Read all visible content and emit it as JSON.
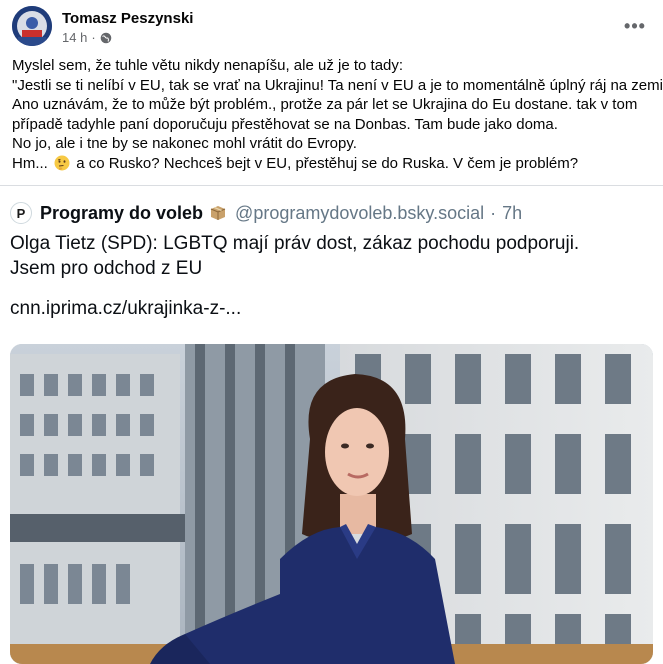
{
  "post": {
    "author": "Tomasz Peszynski",
    "time": "14 h",
    "separator": "·",
    "more_label": "•••",
    "lines": [
      "Myslel sem, že tuhle větu nikdy nenapíšu, ale už je to tady:",
      "\"Jestli se ti nelíbí v EU, tak se vrať na Ukrajinu! Ta není v EU a je to momentálně úplný ráj na zemi!\"",
      "Ano uznávám, že to může být problém., protže za pár let se Ukrajina do Eu dostane. tak v tom",
      "případě tadyhle paní doporučuju přestěhovat se na Donbas. Tam bude jako doma.",
      "No jo, ale i tne by se nakonec mohl vrátit do Evropy."
    ],
    "last_line_start": "Hm...",
    "last_line_end": "a co Rusko? Nechceš bejt v EU, přestěhuj se do Ruska. V čem je problém?"
  },
  "shared": {
    "logo_letter": "P",
    "display_name": "Programy do voleb",
    "handle": "@programydovoleb.bsky.social",
    "dot": "·",
    "time": "7h",
    "text_line1": "Olga Tietz (SPD): LGBTQ mají práv dost, zákaz pochodu podporuji.",
    "text_line2": "Jsem pro odchod z EU",
    "link": "cnn.iprima.cz/ukrajinka-z-..."
  },
  "icons": {
    "globe": "globe-icon",
    "thinking": "thinking-face-emoji",
    "package": "package-box-icon",
    "more": "more-options-icon"
  }
}
